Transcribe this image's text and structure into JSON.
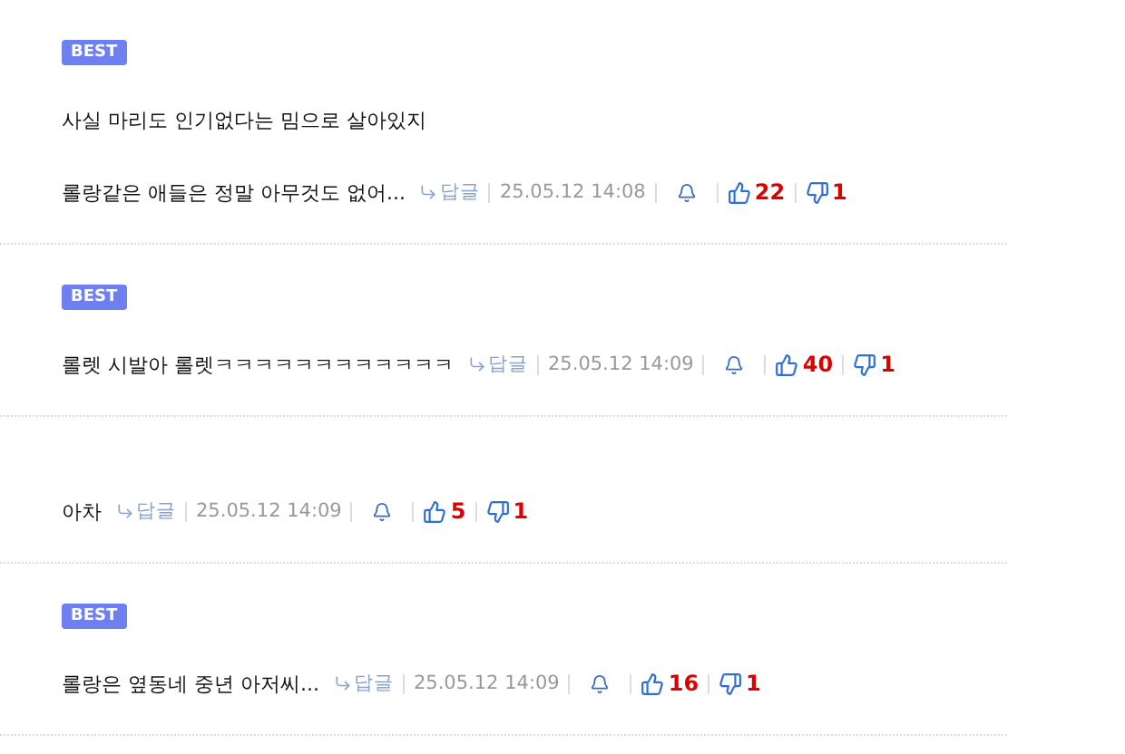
{
  "comments": [
    {
      "best": true,
      "badge": "BEST",
      "lines": [
        "사실 마리도 인기없다는 밈으로 살아있지",
        "롤랑같은 애들은 정말 아무것도 없어..."
      ],
      "reply": "답글",
      "date": "25.05.12 14:08",
      "likes": "22",
      "dislikes": "1"
    },
    {
      "best": true,
      "badge": "BEST",
      "lines": [
        "롤렛 시발아 롤렛ㅋㅋㅋㅋㅋㅋㅋㅋㅋㅋㅋㅋ"
      ],
      "reply": "답글",
      "date": "25.05.12 14:09",
      "likes": "40",
      "dislikes": "1"
    },
    {
      "best": false,
      "lines": [
        "아차"
      ],
      "reply": "답글",
      "date": "25.05.12 14:09",
      "likes": "5",
      "dislikes": "1"
    },
    {
      "best": true,
      "badge": "BEST",
      "lines": [
        "롤랑은 옆동네 중년 아저씨..."
      ],
      "reply": "답글",
      "date": "25.05.12 14:09",
      "likes": "16",
      "dislikes": "1"
    }
  ]
}
